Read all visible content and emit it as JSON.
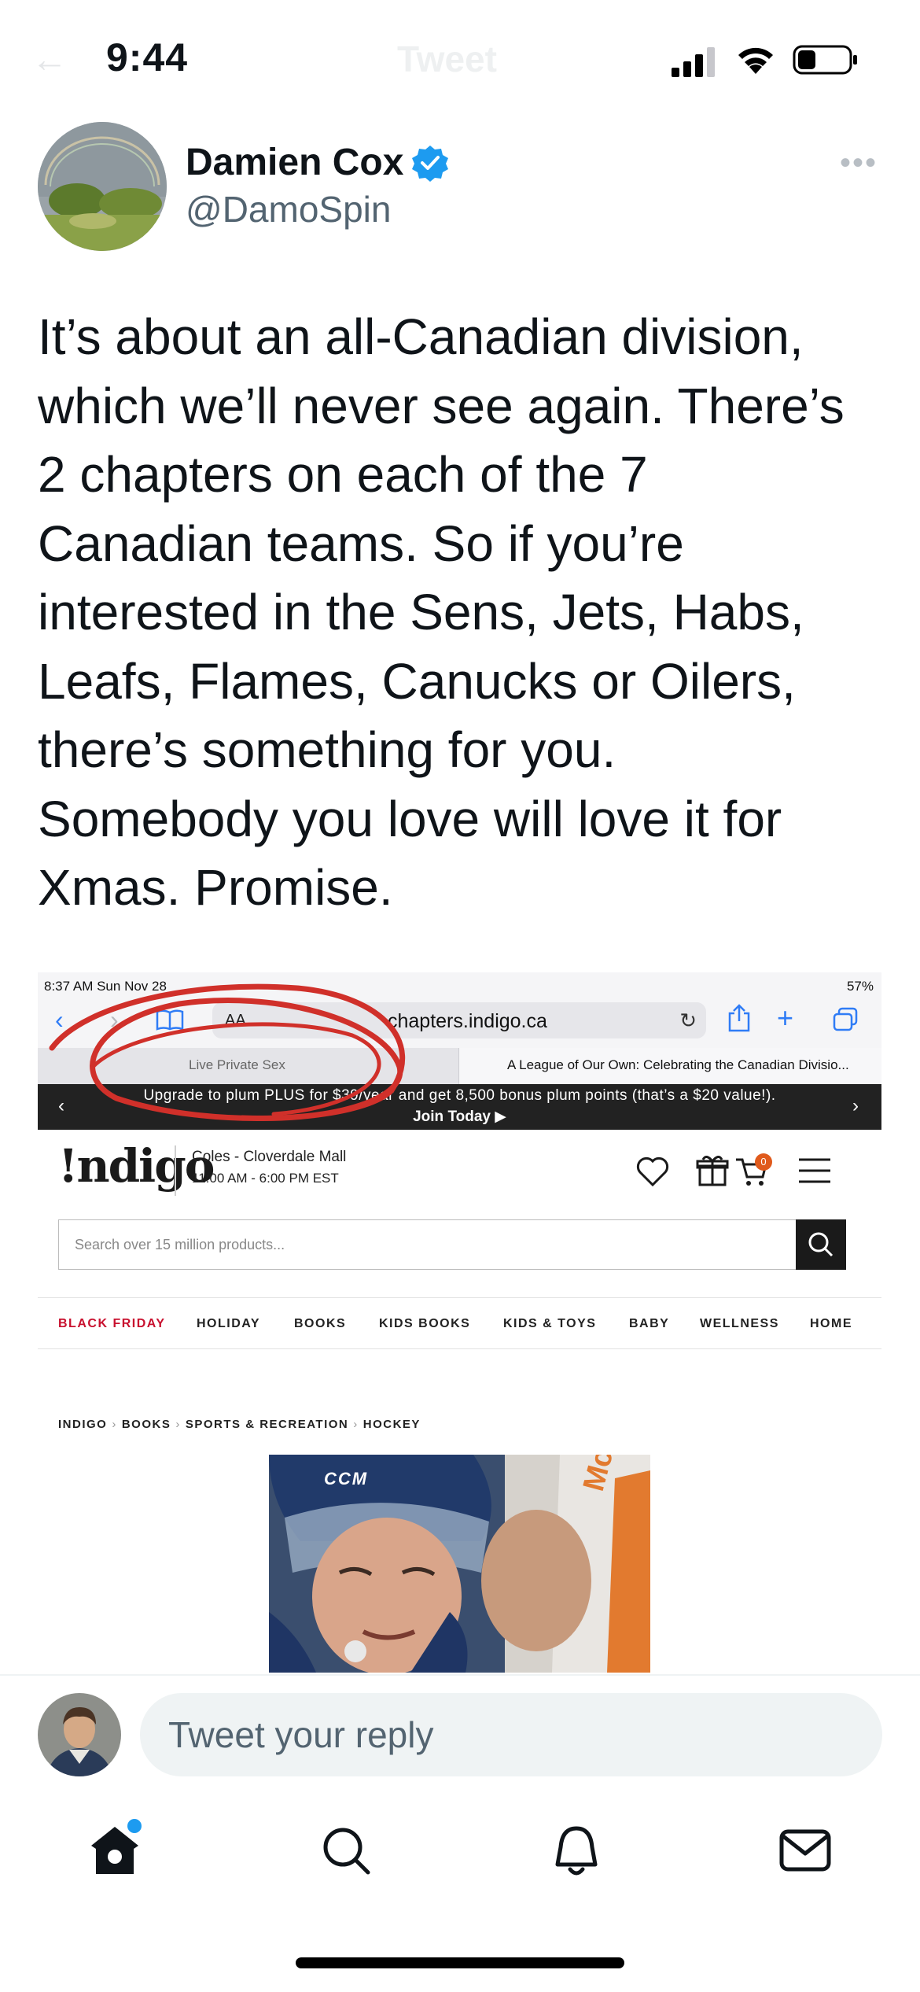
{
  "status_bar": {
    "time": "9:44",
    "faded_back": "←",
    "faded_title": "Tweet"
  },
  "tweet": {
    "author_name": "Damien Cox",
    "author_handle": "@DamoSpin",
    "verified": true,
    "more_glyph": "•••",
    "text": "It’s about an all-Canadian division,\nwhich we’ll never see again. There’s\n2 chapters on each of the 7\nCanadian teams. So if you’re\ninterested in the Sens, Jets, Habs,\nLeafs, Flames, Canucks or Oilers,\nthere’s something for you.\nSomebody you love will love it for\nXmas. Promise."
  },
  "embedded_screenshot": {
    "ipad_time": "8:37 AM   Sun Nov 28",
    "ipad_battery": "57%",
    "url_aa": "AA",
    "url": "chapters.indigo.ca",
    "tab_left": "Live Private Sex",
    "tab_right": "A League of Our Own: Celebrating the Canadian Divisio...",
    "promo_text": "Upgrade to plum PLUS for $39/year and get 8,500 bonus plum points (that’s a $20 value!).",
    "promo_cta": "Join Today ▶",
    "logo": "!ndigo",
    "store_name": "Coles - Cloverdale Mall",
    "store_hours": "11:00 AM - 6:00 PM EST",
    "cart_count": "0",
    "search_placeholder": "Search over 15 million products...",
    "nav": [
      "BLACK FRIDAY",
      "HOLIDAY",
      "BOOKS",
      "KIDS BOOKS",
      "KIDS & TOYS",
      "BABY",
      "WELLNESS",
      "HOME"
    ],
    "breadcrumbs": [
      "INDIGO",
      "BOOKS",
      "SPORTS & RECREATION",
      "HOCKEY"
    ],
    "cover_helmet_text": "CCM",
    "cover_jersey_text": "McD",
    "accent_red": "#c8102e",
    "annotation_color": "#d0302a"
  },
  "reply": {
    "placeholder": "Tweet your reply"
  },
  "tab_bar": {
    "items": [
      "home-icon",
      "search-icon",
      "notifications-icon",
      "messages-icon"
    ],
    "home_has_notification": true
  },
  "colors": {
    "twitter_blue": "#1d9bf0",
    "secondary_text": "#536471",
    "reply_bg": "#eff3f4"
  }
}
